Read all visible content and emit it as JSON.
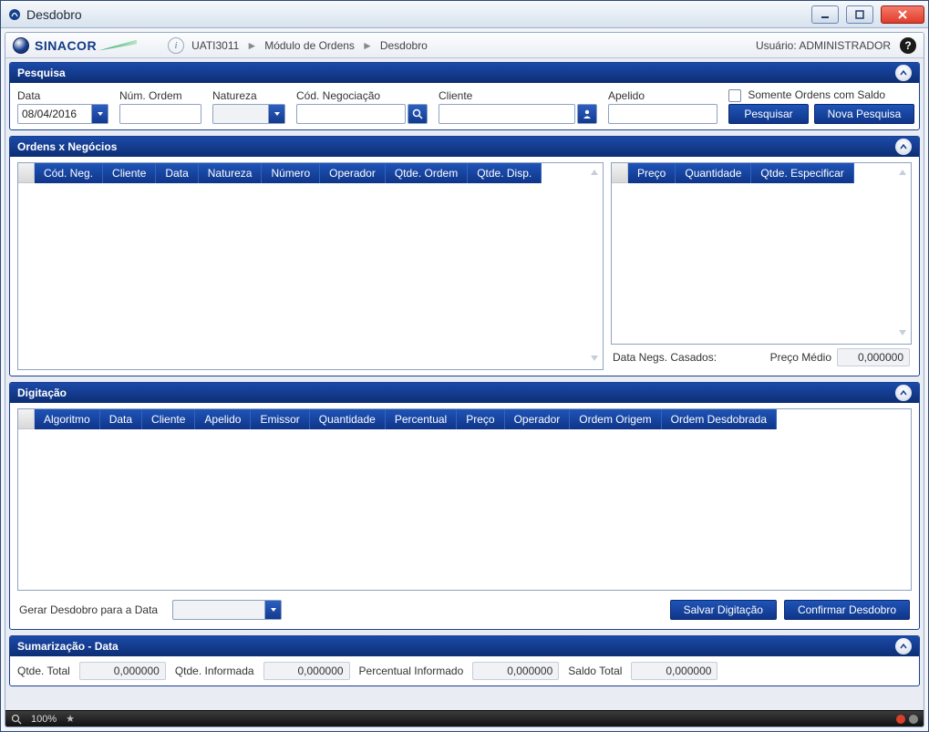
{
  "window": {
    "title": "Desdobro"
  },
  "breadcrumb": {
    "context": "UATI3011",
    "module": "Módulo de Ordens",
    "page": "Desdobro"
  },
  "user": {
    "label": "Usuário:",
    "name": "ADMINISTRADOR"
  },
  "brand": "SINACOR",
  "panel_pesquisa": {
    "title": "Pesquisa",
    "labels": {
      "data": "Data",
      "num_ordem": "Núm. Ordem",
      "natureza": "Natureza",
      "cod_neg": "Cód. Negociação",
      "cliente": "Cliente",
      "apelido": "Apelido",
      "somente_saldo": "Somente Ordens com Saldo"
    },
    "values": {
      "data": "08/04/2016",
      "num_ordem": "",
      "natureza": "",
      "cod_neg": "",
      "cliente": "",
      "apelido": ""
    },
    "btn_pesquisar": "Pesquisar",
    "btn_nova": "Nova Pesquisa"
  },
  "panel_ordens": {
    "title": "Ordens x Negócios",
    "grid_left_cols": [
      "Cód. Neg.",
      "Cliente",
      "Data",
      "Natureza",
      "Número",
      "Operador",
      "Qtde. Ordem",
      "Qtde. Disp."
    ],
    "grid_right_cols": [
      "Preço",
      "Quantidade",
      "Qtde. Especificar"
    ],
    "label_casados": "Data Negs. Casados:",
    "label_preco_medio": "Preço Médio",
    "preco_medio_value": "0,000000"
  },
  "panel_digitacao": {
    "title": "Digitação",
    "grid_cols": [
      "Algoritmo",
      "Data",
      "Cliente",
      "Apelido",
      "Emissor",
      "Quantidade",
      "Percentual",
      "Preço",
      "Operador",
      "Ordem Origem",
      "Ordem Desdobrada"
    ],
    "label_gerar_data": "Gerar Desdobro para a Data",
    "btn_salvar": "Salvar Digitação",
    "btn_confirmar": "Confirmar Desdobro"
  },
  "panel_sumarizacao": {
    "title": "Sumarização - Data",
    "labels": {
      "qtde_total": "Qtde. Total",
      "qtde_informada": "Qtde. Informada",
      "perc_informado": "Percentual Informado",
      "saldo_total": "Saldo Total"
    },
    "values": {
      "qtde_total": "0,000000",
      "qtde_informada": "0,000000",
      "perc_informado": "0,000000",
      "saldo_total": "0,000000"
    }
  },
  "statusbar": {
    "zoom": "100%"
  }
}
